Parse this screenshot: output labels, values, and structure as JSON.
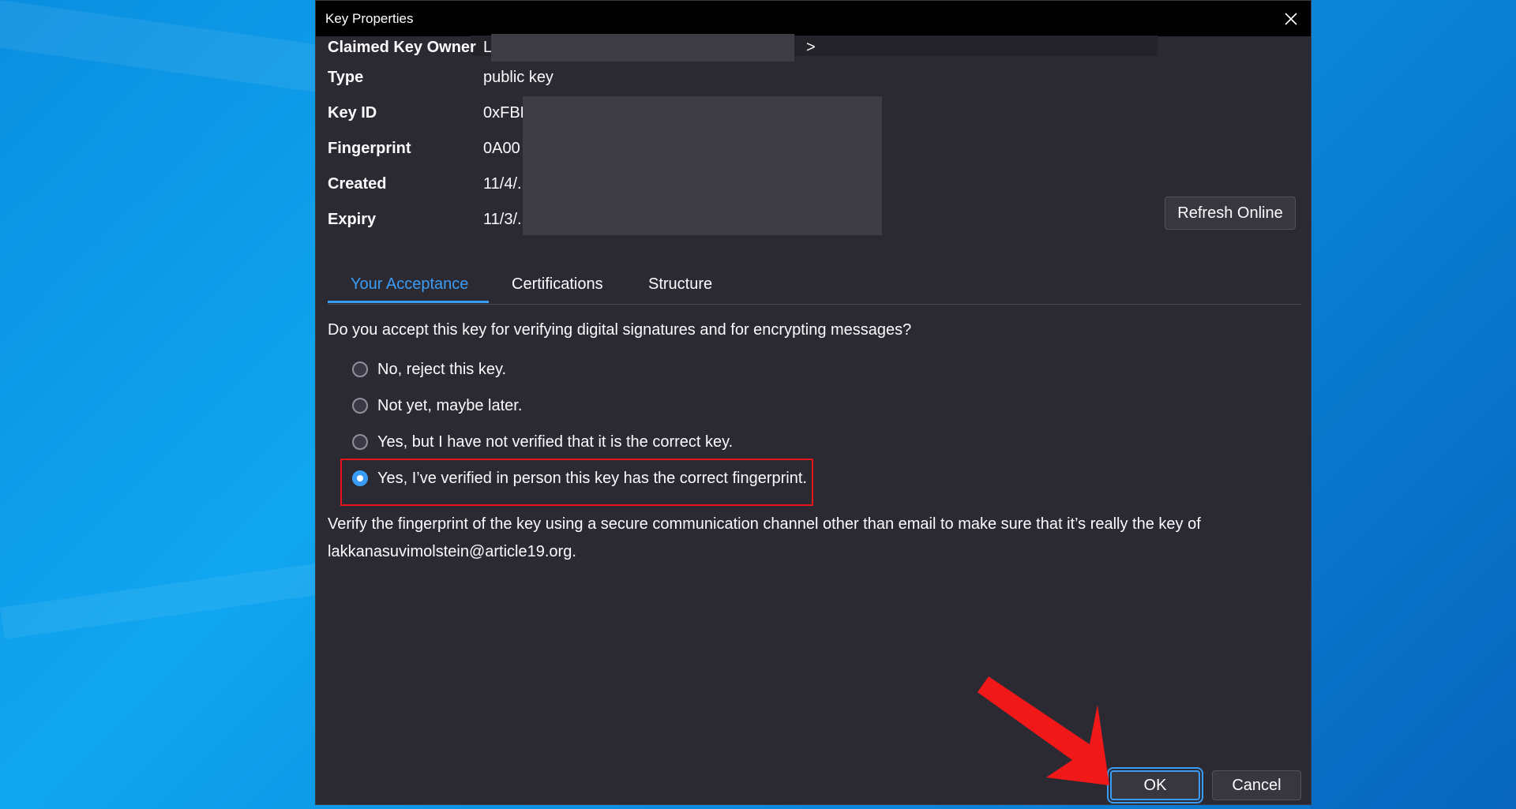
{
  "dialog": {
    "title": "Key Properties"
  },
  "properties": [
    {
      "label": "Claimed Key Owner",
      "value": "L",
      "suffix": ">"
    },
    {
      "label": "Type",
      "value": "public key"
    },
    {
      "label": "Key ID",
      "value": "0xFBD"
    },
    {
      "label": "Fingerprint",
      "value": "0A00"
    },
    {
      "label": "Created",
      "value": "11/4/."
    },
    {
      "label": "Expiry",
      "value": "11/3/."
    }
  ],
  "buttons": {
    "refresh_online": "Refresh Online",
    "ok": "OK",
    "cancel": "Cancel"
  },
  "tabs": [
    {
      "label": "Your Acceptance",
      "active": true
    },
    {
      "label": "Certifications",
      "active": false
    },
    {
      "label": "Structure",
      "active": false
    }
  ],
  "acceptance": {
    "question": "Do you accept this key for verifying digital signatures and for encrypting messages?",
    "options": [
      {
        "label": "No, reject this key.",
        "checked": false
      },
      {
        "label": "Not yet, maybe later.",
        "checked": false
      },
      {
        "label": "Yes, but I have not verified that it is the correct key.",
        "checked": false
      },
      {
        "label": "Yes, I’ve verified in person this key has the correct fingerprint.",
        "checked": true
      }
    ],
    "verify_line1": "Verify the fingerprint of the key using a secure communication channel other than email to make sure that it’s really the key of",
    "verify_line2": "lakkanasuvimolstein@article19.org."
  },
  "colors": {
    "accent": "#3a9cf5",
    "dialog_bg": "#2b2a33",
    "highlight": "#e8141c",
    "arrow": "#f01818"
  },
  "icons": {
    "close": "close-icon",
    "arrow": "red-arrow-annotation"
  }
}
